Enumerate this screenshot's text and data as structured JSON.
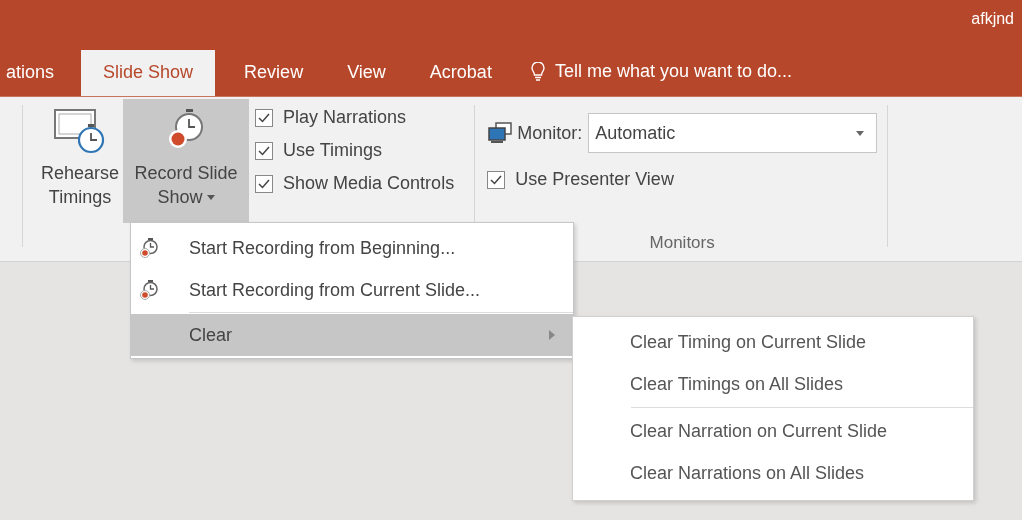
{
  "title_bar": {
    "user": "afkjnd"
  },
  "tabs": [
    {
      "label": "ations",
      "selected": false
    },
    {
      "label": "Slide Show",
      "selected": true
    },
    {
      "label": "Review",
      "selected": false
    },
    {
      "label": "View",
      "selected": false
    },
    {
      "label": "Acrobat",
      "selected": false
    }
  ],
  "tell_me": {
    "placeholder": "Tell me what you want to do..."
  },
  "ribbon": {
    "rehearse_button": {
      "label_lines": [
        "Rehearse",
        "Timings"
      ]
    },
    "record_button": {
      "label_lines": [
        "Record Slide",
        "Show"
      ],
      "selected": true
    },
    "checkboxes": [
      {
        "label": "Play Narrations",
        "checked": true
      },
      {
        "label": "Use Timings",
        "checked": true
      },
      {
        "label": "Show Media Controls",
        "checked": true
      }
    ],
    "monitors": {
      "monitor_label": "Monitor:",
      "monitor_value": "Automatic",
      "presenter_view": {
        "label": "Use Presenter View",
        "checked": true
      },
      "group_label": "Monitors"
    }
  },
  "menu": [
    {
      "kind": "command",
      "label": "Start Recording from Beginning...",
      "selected": false
    },
    {
      "kind": "command",
      "label": "Start Recording from Current Slide...",
      "selected": false
    },
    {
      "kind": "submenu",
      "label": "Clear",
      "selected": true
    }
  ],
  "submenu": [
    [
      {
        "label": "Clear Timing on Current Slide"
      },
      {
        "label": "Clear Timings on All Slides"
      }
    ],
    [
      {
        "label": "Clear Narration on Current Slide"
      },
      {
        "label": "Clear Narrations on All Slides"
      }
    ]
  ]
}
